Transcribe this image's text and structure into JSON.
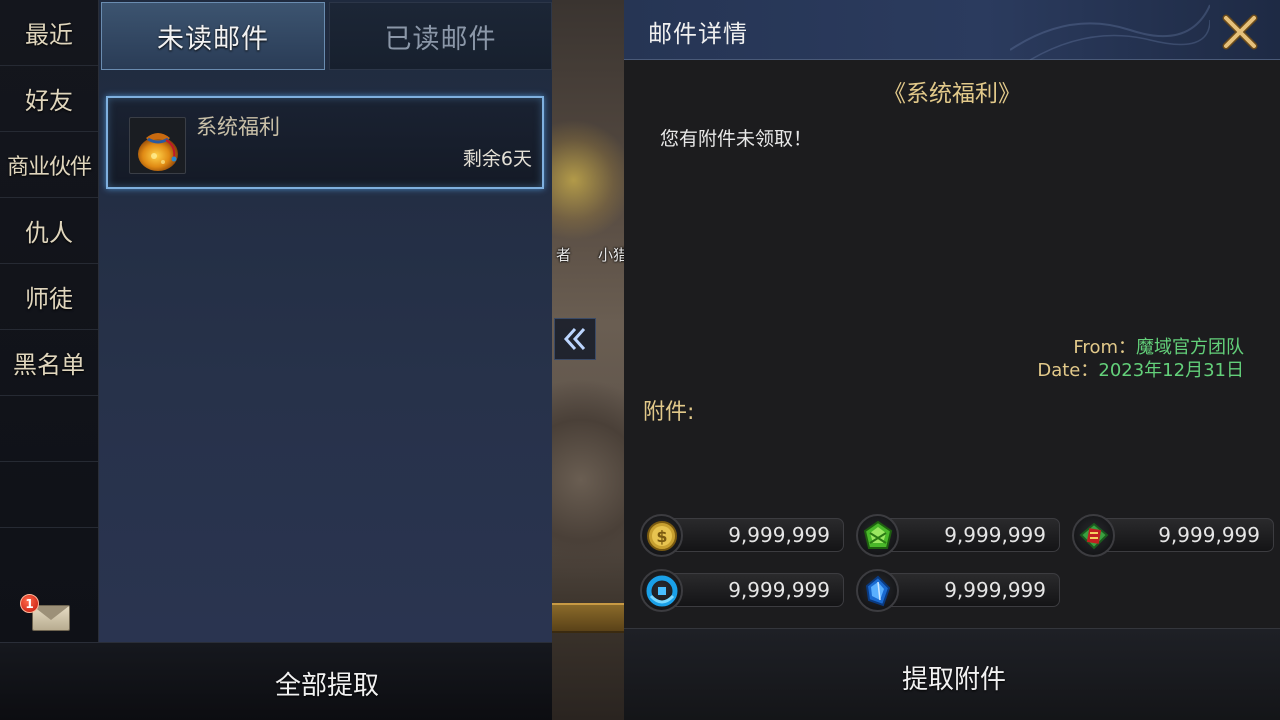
{
  "nav": {
    "items": [
      {
        "label": "最近"
      },
      {
        "label": "好友"
      },
      {
        "label": "商业伙伴"
      },
      {
        "label": "仇人"
      },
      {
        "label": "师徒"
      },
      {
        "label": "黑名单"
      }
    ],
    "mail_badge": "1"
  },
  "tabs": {
    "unread": "未读邮件",
    "read": "已读邮件"
  },
  "mail_list": [
    {
      "title": "系统福利",
      "remaining": "剩余6天",
      "icon": "treasure-bag-icon"
    }
  ],
  "list_footer": {
    "claim_all": "全部提取"
  },
  "scene": {
    "name_left": "者",
    "name_right": "小猎"
  },
  "detail": {
    "header_title": "邮件详情",
    "subject": "《系统福利》",
    "body": "您有附件未领取！",
    "from_label": "From：",
    "from_value": "魔域官方团队",
    "date_label": "Date：",
    "date_value": "2023年12月31日",
    "attachments_label": "附件:",
    "attachments": [
      {
        "icon": "gold-coin-icon",
        "amount": "9,999,999"
      },
      {
        "icon": "green-gem-icon",
        "amount": "9,999,999"
      },
      {
        "icon": "red-ticket-icon",
        "amount": "9,999,999"
      },
      {
        "icon": "blue-orb-icon",
        "amount": "9,999,999"
      },
      {
        "icon": "blue-crystal-icon",
        "amount": "9,999,999"
      }
    ],
    "claim_button": "提取附件"
  },
  "colors": {
    "accent_gold": "#e2c98a",
    "accent_green": "#63d07a",
    "selection_blue": "#7fb0df"
  }
}
